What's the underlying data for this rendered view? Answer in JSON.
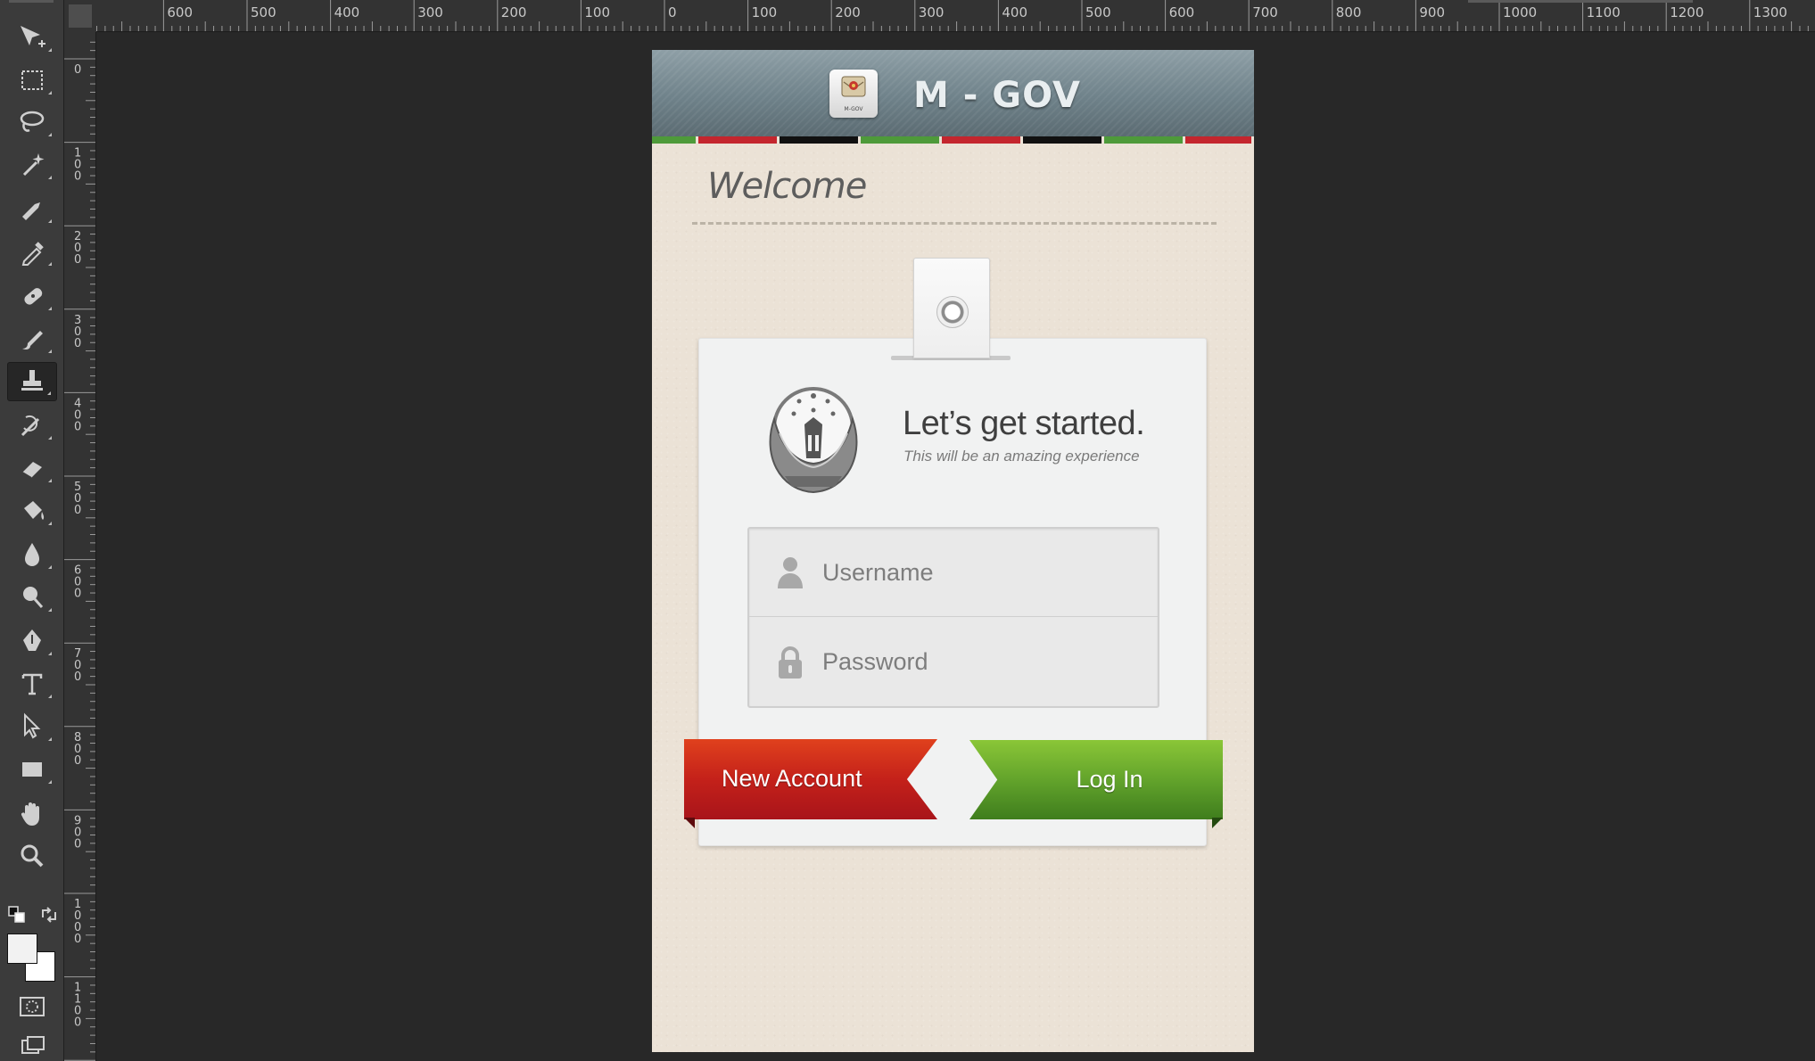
{
  "tools": [
    {
      "name": "move-tool",
      "icon": "move-icon"
    },
    {
      "name": "marquee-tool",
      "icon": "rect-marquee-icon"
    },
    {
      "name": "lasso-tool",
      "icon": "lasso-icon"
    },
    {
      "name": "magic-wand-tool",
      "icon": "magic-wand-icon"
    },
    {
      "name": "crop-tool",
      "icon": "crop-icon"
    },
    {
      "name": "eyedropper-tool",
      "icon": "eyedropper-icon"
    },
    {
      "name": "healing-brush-tool",
      "icon": "bandage-icon"
    },
    {
      "name": "brush-tool",
      "icon": "brush-icon"
    },
    {
      "name": "clone-stamp-tool",
      "icon": "stamp-icon"
    },
    {
      "name": "history-brush-tool",
      "icon": "history-brush-icon"
    },
    {
      "name": "eraser-tool",
      "icon": "eraser-icon"
    },
    {
      "name": "paint-bucket-tool",
      "icon": "bucket-icon"
    },
    {
      "name": "blur-tool",
      "icon": "drop-icon"
    },
    {
      "name": "dodge-tool",
      "icon": "dodge-icon"
    },
    {
      "name": "pen-tool",
      "icon": "pen-icon"
    },
    {
      "name": "type-tool",
      "icon": "type-icon"
    },
    {
      "name": "path-selection-tool",
      "icon": "arrow-icon"
    },
    {
      "name": "rectangle-tool",
      "icon": "rectangle-icon"
    },
    {
      "name": "hand-tool",
      "icon": "hand-icon"
    },
    {
      "name": "zoom-tool",
      "icon": "zoom-icon"
    }
  ],
  "active_tool": "clone-stamp-tool",
  "colors": {
    "workspace": "#282828",
    "panel": "#3b3b3b",
    "header_top": "#8e9fa6",
    "header_bottom": "#5b6b72",
    "paper": "#ebe2d6",
    "flag_green": "#4e9a3a",
    "flag_red": "#c4262e",
    "flag_black": "#111111",
    "button_red": "#c4211a",
    "button_green": "#5fa02a"
  },
  "ruler_top_labels": [
    "600",
    "500",
    "400",
    "300",
    "200",
    "100",
    "0",
    "100",
    "200",
    "300",
    "400",
    "500",
    "600",
    "700",
    "800",
    "900",
    "1000",
    "1100",
    "1200",
    "1300"
  ],
  "ruler_left_labels": [
    "0",
    "100",
    "200",
    "300",
    "400",
    "500",
    "600",
    "700",
    "800",
    "900",
    "1000",
    "1100"
  ],
  "app": {
    "logo_caption": "M-GOV",
    "title": "M - GOV",
    "flag_stripes": [
      "green",
      "red",
      "black",
      "green",
      "red",
      "black",
      "green",
      "red"
    ],
    "welcome": "Welcome",
    "headline": "Let’s get started.",
    "subheadline": "This will be an amazing experience",
    "username_placeholder": "Username",
    "password_placeholder": "Password",
    "new_account_label": "New Account",
    "login_label": "Log In"
  }
}
